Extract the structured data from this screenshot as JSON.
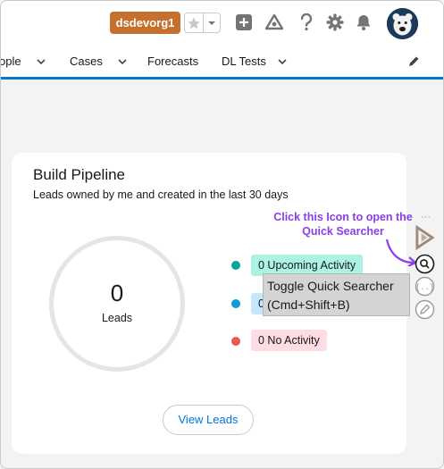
{
  "header": {
    "org_name": "dsdevorg1",
    "icons": [
      "star-icon",
      "chevron-down-icon",
      "add-icon",
      "trailhead-icon",
      "help-icon",
      "setup-gear-icon",
      "bell-icon",
      "avatar-icon"
    ]
  },
  "nav": {
    "items": [
      {
        "label": "ople",
        "has_menu": true
      },
      {
        "label": "Cases",
        "has_menu": true
      },
      {
        "label": "Forecasts",
        "has_menu": false
      },
      {
        "label": "DL Tests",
        "has_menu": true
      }
    ]
  },
  "card": {
    "title": "Build Pipeline",
    "subtitle": "Leads owned by me and created in the last 30 days",
    "total_value": "0",
    "total_label": "Leads",
    "legend": [
      {
        "label": "0 Upcoming Activity",
        "dot_color": "#06a59a",
        "bg_color": "#acf3e4"
      },
      {
        "label": "0",
        "dot_color": "#0d9dda",
        "bg_color": "#c6e6fb"
      },
      {
        "label": "0 No Activity",
        "dot_color": "#ea5a4e",
        "bg_color": "#fddde3"
      }
    ],
    "button_label": "View Leads"
  },
  "overlay": {
    "hint_text": "Click this Icon to open the Quick Searcher",
    "tooltip_line1": "Toggle Quick Searcher",
    "tooltip_line2": "(Cmd+Shift+B)"
  },
  "colors": {
    "accent": "#0176d3",
    "org_badge": "#c5702f",
    "hint": "#8a3ee8"
  }
}
